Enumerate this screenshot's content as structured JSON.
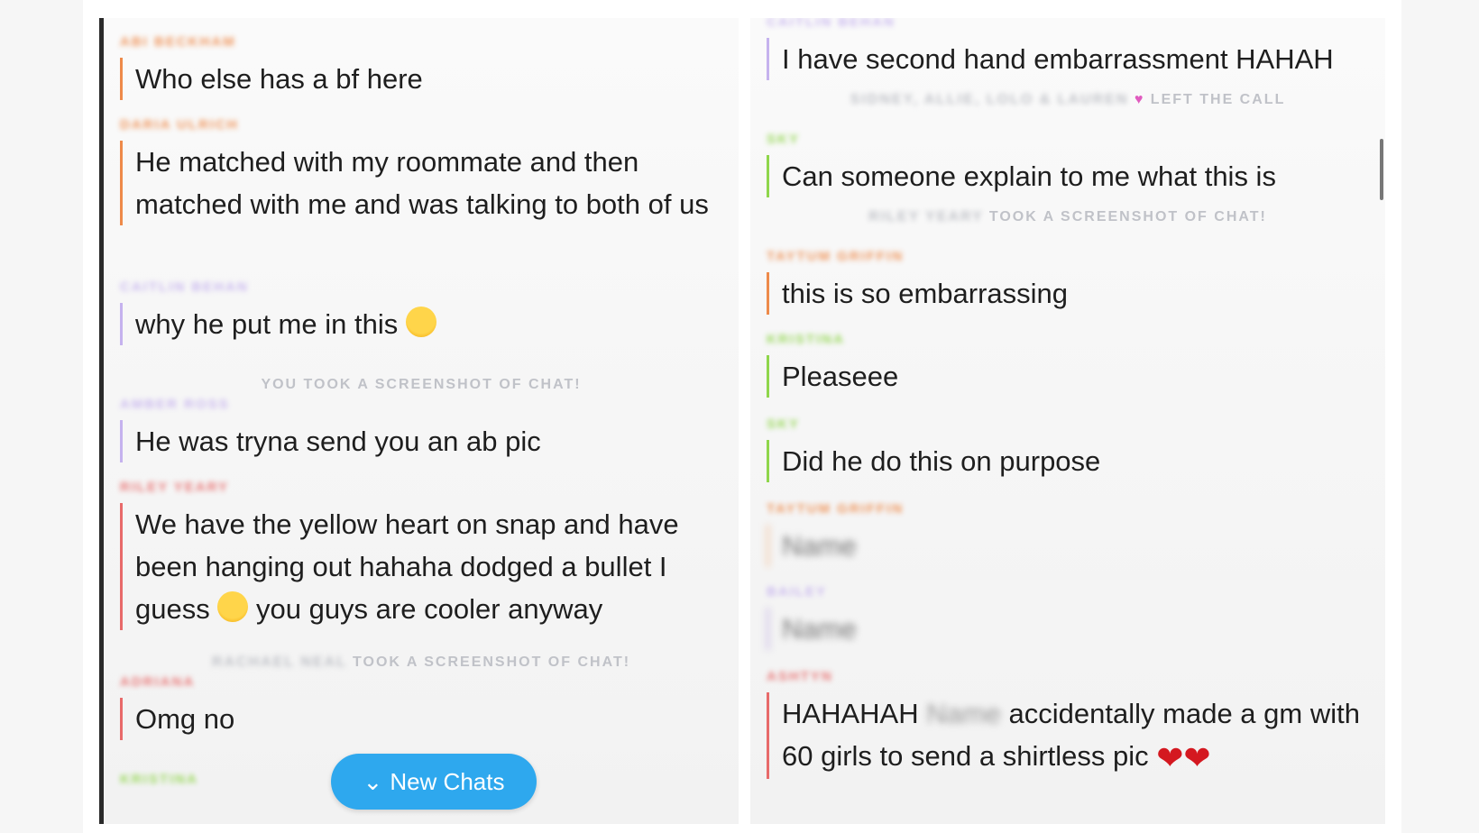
{
  "colors": {
    "orange": "#ee8a4a",
    "purple": "#c5b2ee",
    "red": "#e86a6a",
    "green": "#8fd64b",
    "blue": "#2ea8ee",
    "pink": "#e05bbf"
  },
  "left_panel": {
    "messages": [
      {
        "sender": "ABI BECKHAM",
        "text": "Who else has a bf here"
      },
      {
        "sender": "DARIA ULRICH",
        "text": "He matched with my roommate and then matched with me and was talking to both of us"
      },
      {
        "sender": "CAITLIN BEHAN",
        "text": "why he put me in this",
        "emoji": "crying-face-emoji"
      },
      {
        "sender": "AMBER ROSS",
        "text": "He was tryna send you an ab pic"
      },
      {
        "sender": "RILEY YEARY",
        "text_before": "We have the yellow heart on snap and have been hanging out hahaha dodged a bullet I guess",
        "text_after": "you guys are cooler anyway",
        "emoji": "upside-down-face-emoji"
      },
      {
        "sender": "ADRIANA",
        "text": "Omg no"
      },
      {
        "sender": "KRISTINA"
      }
    ],
    "system": [
      {
        "text": "YOU TOOK A SCREENSHOT OF CHAT!"
      },
      {
        "name": "RACHAEL NEAL",
        "text": "TOOK A SCREENSHOT OF CHAT!"
      }
    ],
    "new_chats_label": "New Chats"
  },
  "right_panel": {
    "messages": [
      {
        "sender": "CAITLIN BEHAN",
        "text": "I have second hand embarrassment HAHAH"
      },
      {
        "sender": "SKY",
        "text": "Can someone explain to me what this is"
      },
      {
        "sender": "TAYTUM GRIFFIN",
        "text": "this is so embarrassing"
      },
      {
        "sender": "KRISTINA",
        "text": "Pleaseee"
      },
      {
        "sender": "SKY",
        "text": "Did he do this on purpose"
      },
      {
        "sender": "TAYTUM GRIFFIN",
        "text": "Name"
      },
      {
        "sender": "BAILEY",
        "text": "Name"
      },
      {
        "sender": "ASHTYN",
        "text_before": "HAHAHAH",
        "hidden": "Name",
        "text_after": "accidentally made a gm with 60 girls to send a shirtless pic",
        "hearts": "❤❤"
      }
    ],
    "system": [
      {
        "name": "SIDNEY, ALLIE, LOLO & LAUREN",
        "text": "LEFT THE CALL"
      },
      {
        "name": "RILEY YEARY",
        "text": "TOOK A SCREENSHOT OF CHAT!"
      }
    ]
  }
}
